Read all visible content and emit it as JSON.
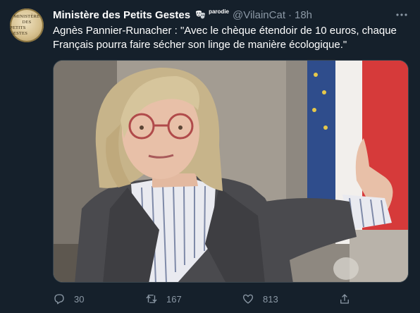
{
  "tweet": {
    "avatar_lines": [
      "MINISTÈRE",
      "DES",
      "PETITS GESTES"
    ],
    "display_name": "Ministère des Petits Gestes",
    "parody_label": "parodie",
    "handle": "@VilainCat",
    "separator": "·",
    "time": "18h",
    "text": "Agnès Pannier-Runacher : \"Avec le chèque étendoir de 10 euros, chaque Français pourra faire sécher son linge de manière écologique.\"",
    "image_icon": "photo",
    "actions": {
      "reply_count": "30",
      "retweet_count": "167",
      "like_count": "813"
    }
  },
  "colors": {
    "background": "#15202b",
    "primary_text": "#ffffff",
    "secondary_text": "#8b98a5",
    "border": "#38444d"
  },
  "icons": {
    "more": "more-horizontal-icon",
    "reply": "reply-icon",
    "retweet": "retweet-icon",
    "like": "heart-icon",
    "share": "share-icon",
    "parody_badge": "masks-icon"
  }
}
